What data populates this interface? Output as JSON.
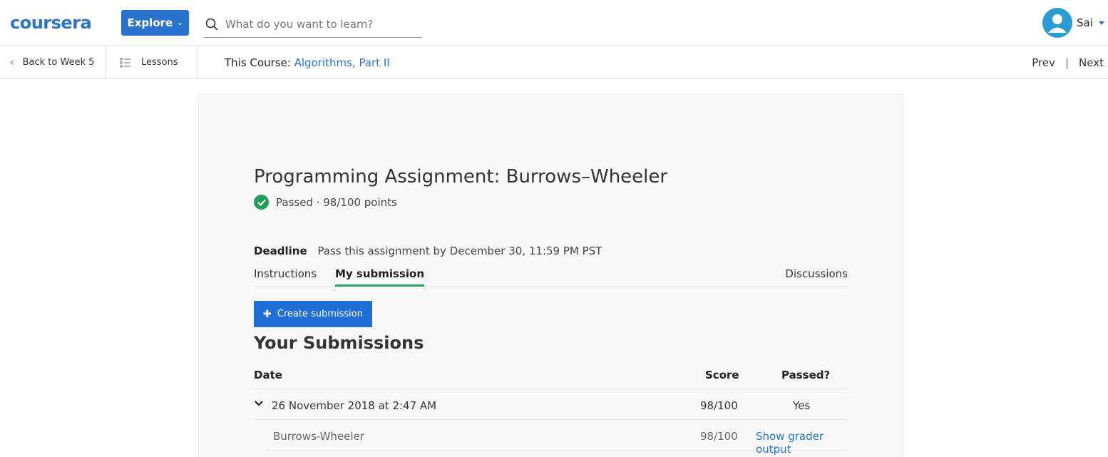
{
  "header": {
    "logo": "coursera",
    "explore_label": "Explore",
    "search_placeholder": "What do you want to learn?",
    "user_name": "Sai"
  },
  "subnav": {
    "back_label": "Back to Week 5",
    "lessons_label": "Lessons",
    "course_prefix": "This Course:",
    "course_name": "Algorithms, Part II",
    "prev_label": "Prev",
    "separator": "|",
    "next_label": "Next"
  },
  "assignment": {
    "title": "Programming Assignment: Burrows–Wheeler",
    "status": "Passed · 98/100 points",
    "deadline_label": "Deadline",
    "deadline_text": "Pass this assignment by December 30, 11:59 PM PST"
  },
  "tabs": [
    {
      "label": "Instructions",
      "active": false
    },
    {
      "label": "My submission",
      "active": true
    },
    {
      "label": "Discussions",
      "active": false
    }
  ],
  "create_button_label": "Create submission",
  "submissions": {
    "title": "Your Submissions",
    "columns": [
      "Date",
      "Score",
      "Passed?"
    ],
    "rows": [
      {
        "date": "26 November 2018 at 2:47 AM",
        "score": "98/100",
        "passed": "Yes"
      }
    ],
    "sub_rows": [
      {
        "name": "Burrows-Wheeler",
        "score": "98/100",
        "action": "Show grader output"
      }
    ]
  },
  "colors": {
    "brand": "#2a73cc",
    "success": "#1f9e57",
    "tab_underline": "#2aa05f"
  }
}
